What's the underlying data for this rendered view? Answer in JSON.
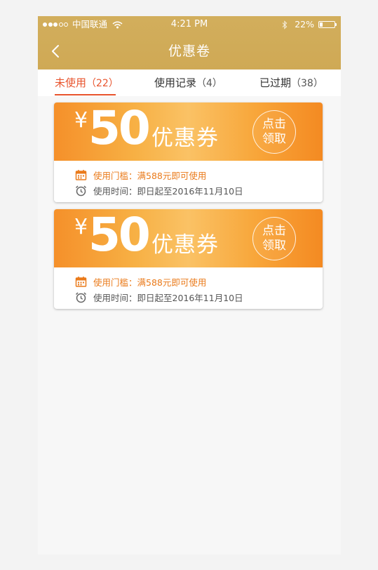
{
  "status_bar": {
    "signal_dots": [
      true,
      true,
      true,
      false,
      false
    ],
    "carrier": "中国联通",
    "time": "4:21 PM",
    "battery": "22%",
    "battery_level": 0.22
  },
  "navbar": {
    "title": "优惠卷",
    "back_icon": "chevron-left-icon"
  },
  "tabs": [
    {
      "label": "未使用",
      "count": "（22）",
      "active": true
    },
    {
      "label": "使用记录",
      "count": "（4）",
      "active": false
    },
    {
      "label": "已过期",
      "count": "（38）",
      "active": false
    }
  ],
  "coupons": [
    {
      "currency": "¥",
      "amount": "50",
      "label": "优惠券",
      "claim_line1": "点击",
      "claim_line2": "领取",
      "threshold": "使用门槛：满588元即可使用",
      "validity": "使用时间：即日起至2016年11月10日"
    },
    {
      "currency": "¥",
      "amount": "50",
      "label": "优惠券",
      "claim_line1": "点击",
      "claim_line2": "领取",
      "threshold": "使用门槛：满588元即可使用",
      "validity": "使用时间：即日起至2016年11月10日"
    }
  ],
  "colors": {
    "header": "#d0ac58",
    "accent": "#e8542d",
    "coupon_orange": "#f5902a",
    "threshold_text": "#ea7a1a"
  }
}
